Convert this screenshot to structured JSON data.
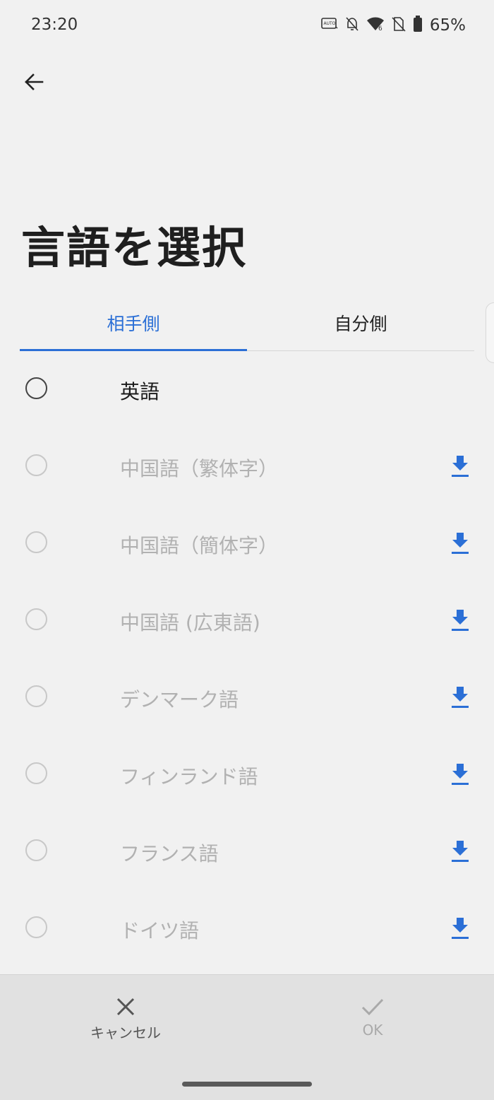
{
  "status_bar": {
    "time": "23:20",
    "battery_percent": "65%",
    "icons": [
      "auto-hz-icon",
      "bell-off-icon",
      "wifi-icon",
      "no-sim-icon",
      "battery-icon"
    ]
  },
  "header": {
    "title": "言語を選択"
  },
  "tabs": [
    {
      "label": "相手側",
      "selected": true
    },
    {
      "label": "自分側",
      "selected": false
    }
  ],
  "languages": [
    {
      "label": "英語",
      "downloaded": true
    },
    {
      "label": "中国語（繁体字）",
      "downloaded": false
    },
    {
      "label": "中国語（簡体字）",
      "downloaded": false
    },
    {
      "label": "中国語 (広東語)",
      "downloaded": false
    },
    {
      "label": "デンマーク語",
      "downloaded": false
    },
    {
      "label": "フィンランド語",
      "downloaded": false
    },
    {
      "label": "フランス語",
      "downloaded": false
    },
    {
      "label": "ドイツ語",
      "downloaded": false
    }
  ],
  "bottom_bar": {
    "cancel_label": "キャンセル",
    "ok_label": "OK"
  },
  "colors": {
    "accent": "#2b6fd6",
    "background": "#f1f1f1",
    "disabled_text": "#b1b1b1",
    "bottom_bar": "#e1e1e1"
  }
}
